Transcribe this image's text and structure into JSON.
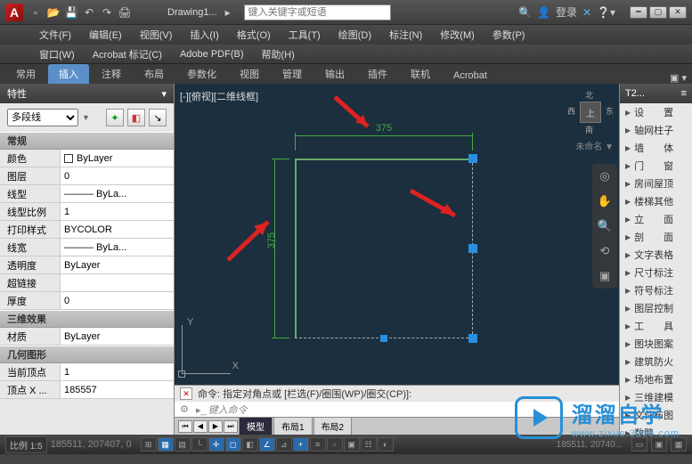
{
  "titlebar": {
    "doc": "Drawing1...",
    "search_ph": "键入关键字或短语",
    "login": "登录"
  },
  "menubar1": [
    "文件(F)",
    "编辑(E)",
    "视图(V)",
    "插入(I)",
    "格式(O)",
    "工具(T)",
    "绘图(D)",
    "标注(N)",
    "修改(M)",
    "参数(P)"
  ],
  "menubar2": [
    "窗口(W)",
    "Acrobat 标记(C)",
    "Adobe PDF(B)",
    "帮助(H)"
  ],
  "ribbon_tabs": [
    "常用",
    "插入",
    "注释",
    "布局",
    "参数化",
    "视图",
    "管理",
    "输出",
    "插件",
    "联机",
    "Acrobat"
  ],
  "ribbon_active": 1,
  "properties": {
    "title": "特性",
    "selector": "多段线",
    "groups": [
      {
        "name": "常规",
        "rows": [
          {
            "label": "颜色",
            "val": "ByLayer",
            "swatch": true
          },
          {
            "label": "图层",
            "val": "0"
          },
          {
            "label": "线型",
            "val": "——— ByLa..."
          },
          {
            "label": "线型比例",
            "val": "1"
          },
          {
            "label": "打印样式",
            "val": "BYCOLOR"
          },
          {
            "label": "线宽",
            "val": "——— ByLa..."
          },
          {
            "label": "透明度",
            "val": "ByLayer"
          },
          {
            "label": "超链接",
            "val": ""
          },
          {
            "label": "厚度",
            "val": "0"
          }
        ]
      },
      {
        "name": "三维效果",
        "rows": [
          {
            "label": "材质",
            "val": "ByLayer"
          }
        ]
      },
      {
        "name": "几何图形",
        "rows": [
          {
            "label": "当前顶点",
            "val": "1"
          },
          {
            "label": "顶点 X ...",
            "val": "185557"
          }
        ]
      }
    ]
  },
  "canvas": {
    "view_label": "[-][俯视][二维线框]",
    "dim_h": "375",
    "dim_v": "375",
    "nav_top": "上",
    "nav_n": "北",
    "nav_s": "南",
    "nav_w": "西",
    "nav_e": "东",
    "nav_un": "未命名 ▼",
    "layout_tabs": [
      "模型",
      "布局1",
      "布局2"
    ]
  },
  "cmd": {
    "hist": "命令: 指定对角点或 [栏选(F)/圈围(WP)/圈交(CP)]:",
    "prompt": "键入命令"
  },
  "right_panel": {
    "title": "T2...",
    "items": [
      "设　　置",
      "轴网柱子",
      "墙　　体",
      "门　　窗",
      "房间屋顶",
      "楼梯其他",
      "立　　面",
      "剖　　面",
      "文字表格",
      "尺寸标注",
      "符号标注",
      "图层控制",
      "工　　具",
      "图块图案",
      "建筑防火",
      "场地布置",
      "三维建模",
      "文件布图",
      "数䴉"
    ]
  },
  "statusbar": {
    "scale": "比例 1:5",
    "coords": "185511, 207407, 0",
    "extra": "185511, 20740..."
  },
  "ucs": {
    "x": "X",
    "y": "Y"
  },
  "overlay": {
    "text1": "溜溜自学",
    "text2": "www.zixue.3d66.com"
  }
}
